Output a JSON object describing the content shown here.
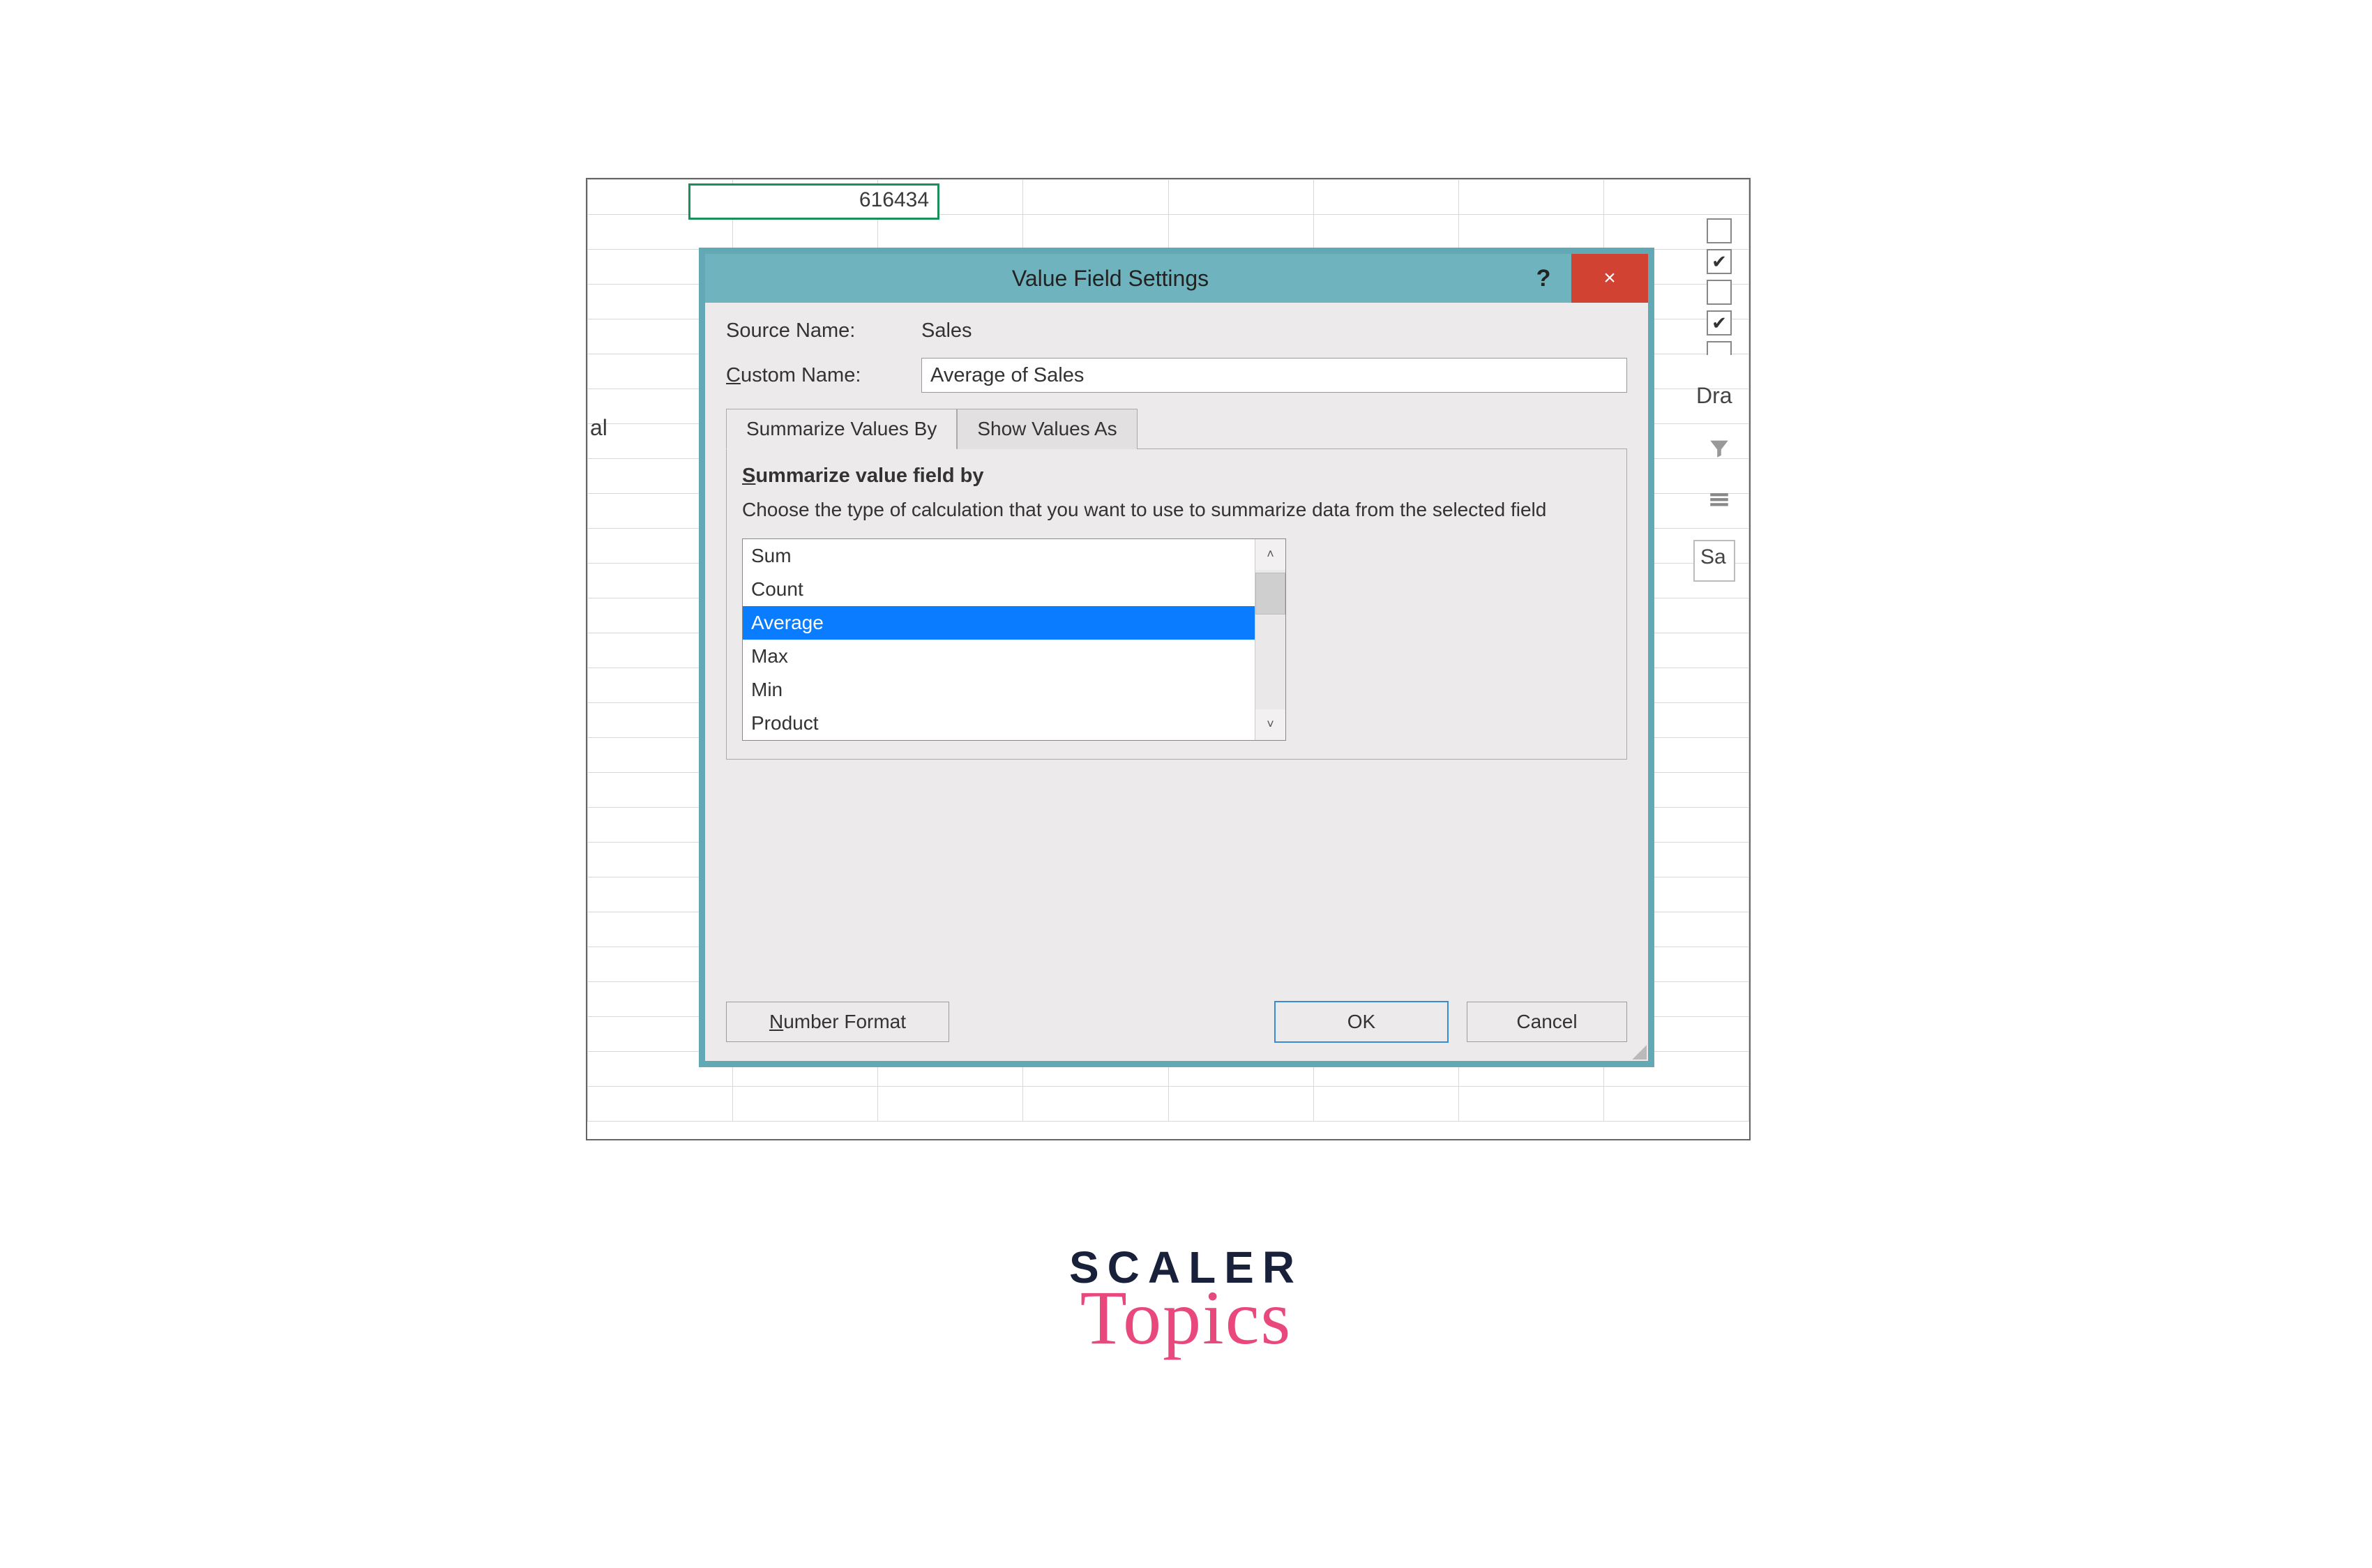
{
  "excel": {
    "active_cell_value": "616434",
    "left_fragment": "al",
    "field_list": {
      "checkboxes": [
        false,
        true,
        false,
        true,
        false
      ],
      "dra_text": "Dra",
      "sa_text": "Sa"
    }
  },
  "dialog": {
    "title": "Value Field Settings",
    "help_symbol": "?",
    "close_symbol": "×",
    "source_name_label": "Source Name:",
    "source_name_value": "Sales",
    "custom_name_label_pre": "C",
    "custom_name_label_rest": "ustom Name:",
    "custom_name_value": "Average of Sales",
    "tabs": {
      "summarize": "Summarize Values By",
      "showas": "Show Values As"
    },
    "panel_heading_pre": "S",
    "panel_heading_rest": "ummarize value field by",
    "panel_desc": "Choose the type of calculation that you want to use to summarize data from the selected field",
    "functions": [
      "Sum",
      "Count",
      "Average",
      "Max",
      "Min",
      "Product"
    ],
    "selected_function_index": 2,
    "number_format_pre": "N",
    "number_format_rest": "umber Format",
    "ok_label": "OK",
    "cancel_label": "Cancel"
  },
  "watermark": {
    "line1": "SCALER",
    "line2": "Topics"
  }
}
